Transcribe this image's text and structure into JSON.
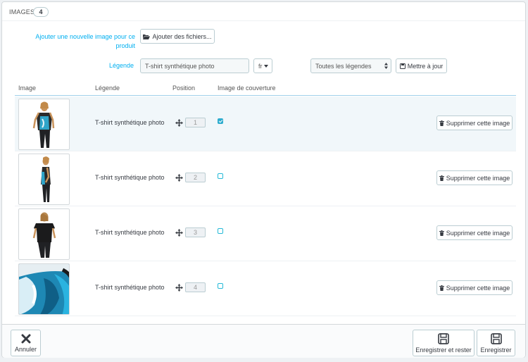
{
  "panel": {
    "title": "Images",
    "count": "4"
  },
  "form": {
    "add_label": "Ajouter une nouvelle image pour ce produit",
    "add_button": "Ajouter des fichiers...",
    "legend_label": "Légende",
    "legend_value": "T-shirt synthétique photo",
    "lang": "fr",
    "legend_scope": "Toutes les légendes",
    "update_button": "Mettre à jour"
  },
  "table": {
    "columns": [
      "Image",
      "Légende",
      "Position",
      "Image de couverture"
    ],
    "rows": [
      {
        "caption": "T-shirt synthétique photo",
        "position": "1",
        "cover": true,
        "delete": "Supprimer cette image"
      },
      {
        "caption": "T-shirt synthétique photo",
        "position": "2",
        "cover": false,
        "delete": "Supprimer cette image"
      },
      {
        "caption": "T-shirt synthétique photo",
        "position": "3",
        "cover": false,
        "delete": "Supprimer cette image"
      },
      {
        "caption": "T-shirt synthétique photo",
        "position": "4",
        "cover": false,
        "delete": "Supprimer cette image"
      }
    ]
  },
  "footer": {
    "cancel": "Annuler",
    "save_stay": "Enregistrer et rester",
    "save": "Enregistrer"
  },
  "colors": {
    "accent": "#00aff0",
    "checkbox": "#2eacce",
    "border": "#bbcdd2"
  }
}
